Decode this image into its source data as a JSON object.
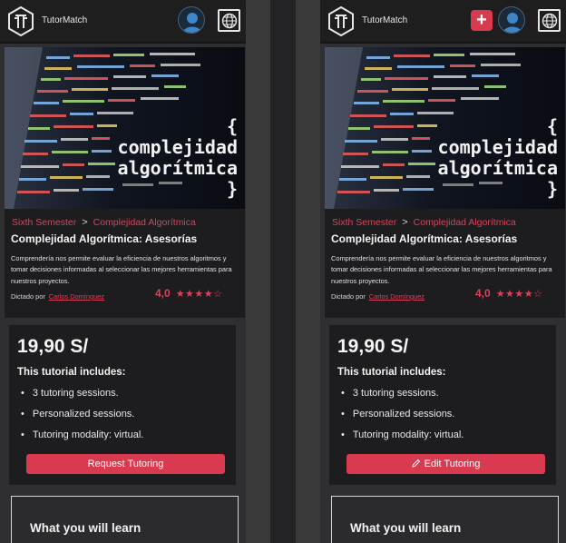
{
  "left": {
    "brand": "TutorMatch",
    "hero_title": [
      "{",
      "complejidad",
      "algorítmica",
      "}"
    ],
    "breadcrumb": {
      "semester": "Sixth Semester",
      "sep": ">",
      "course": "Complejidad Algorítmica"
    },
    "title": "Complejidad Algorítmica: Asesorías",
    "description": "Comprendería nos permite evaluar la eficiencia de nuestros algoritmos y tomar decisiones informadas al seleccionar las mejores herramientas para nuestros proyectos.",
    "by_label": "Dictado por",
    "author": "Carlos Domínguez",
    "rating_value": "4,0",
    "stars": "★★★★☆",
    "price": "19,90 S/",
    "includes_title": "This tutorial includes:",
    "features": [
      "3 tutoring sessions.",
      "Personalized sessions.",
      "Tutoring modality: virtual."
    ],
    "bullet": "•",
    "cta": "Request Tutoring",
    "learn_title": "What you will learn"
  },
  "right": {
    "brand": "TutorMatch",
    "plus": "+",
    "hero_title": [
      "{",
      "complejidad",
      "algorítmica",
      "}"
    ],
    "breadcrumb": {
      "semester": "Sixth Semester",
      "sep": ">",
      "course": "Complejidad Algorítmica"
    },
    "title": "Complejidad Algorítmica: Asesorías",
    "description": "Comprendería nos permite evaluar la eficiencia de nuestros algoritmos y tomar decisiones informadas al seleccionar las mejores herramientas para nuestros proyectos.",
    "by_label": "Dictado por",
    "author": "Carlos Domínguez",
    "rating_value": "4,0",
    "stars": "★★★★☆",
    "price": "19,90 S/",
    "includes_title": "This tutorial includes:",
    "features": [
      "3 tutoring sessions.",
      "Personalized sessions.",
      "Tutoring modality: virtual."
    ],
    "bullet": "•",
    "cta": "Edit Tutoring",
    "learn_title": "What you will learn"
  },
  "icons": {
    "logo": "tutormatch-logo-icon",
    "avatar": "user-avatar-icon",
    "globe": "globe-icon",
    "plus": "plus-icon",
    "edit": "pencil-icon"
  },
  "colors": {
    "accent": "#d93a4f",
    "topbar": "#1e1e1f",
    "card": "#1d1d1f",
    "panel_bg": "#2f2f31"
  }
}
